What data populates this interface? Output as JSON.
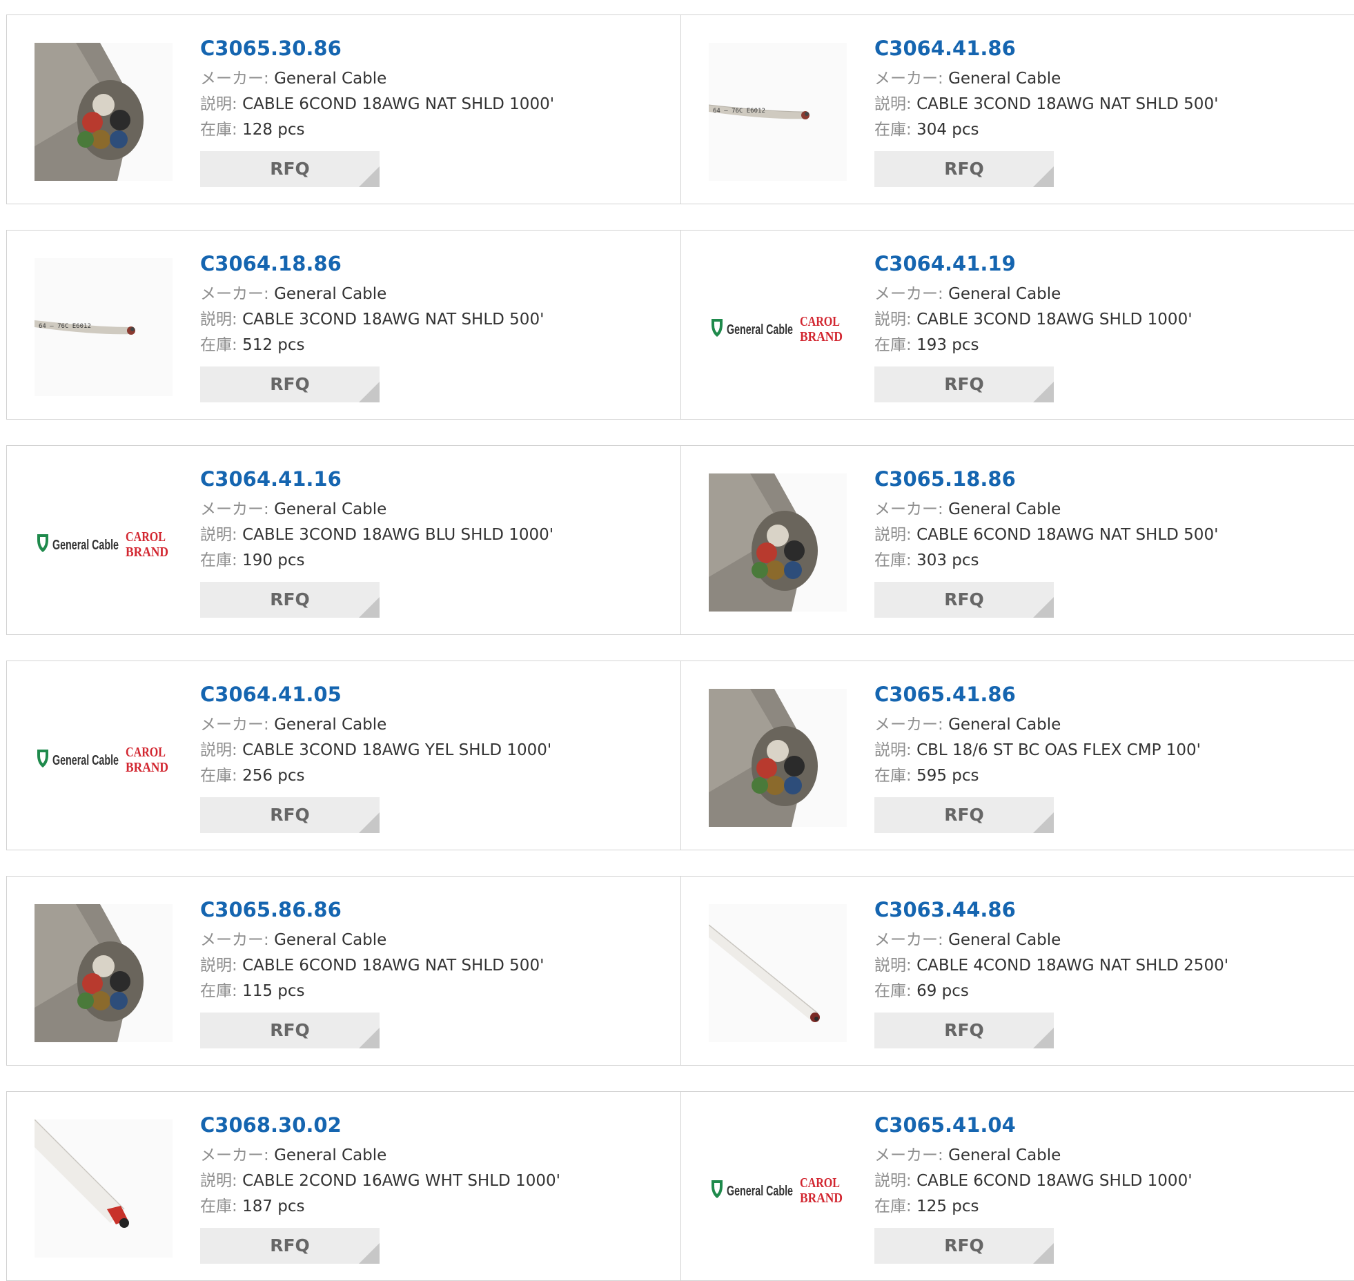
{
  "labels": {
    "maker": "メーカー:",
    "desc": "説明:",
    "stock": "在庫:"
  },
  "products": [
    {
      "pn": "C3065.30.86",
      "maker": "General Cable",
      "desc": "CABLE 6COND 18AWG NAT SHLD 1000'",
      "stock": "128 pcs",
      "rfq": "RFQ",
      "image": "cable-end-multi-icon"
    },
    {
      "pn": "C3064.41.86",
      "maker": "General Cable",
      "desc": "CABLE 3COND 18AWG NAT SHLD 500'",
      "stock": "304 pcs",
      "rfq": "RFQ",
      "image": "cable-thin-printed-icon"
    },
    {
      "pn": "C3064.18.86",
      "maker": "General Cable",
      "desc": "CABLE 3COND 18AWG NAT SHLD 500'",
      "stock": "512 pcs",
      "rfq": "RFQ",
      "image": "cable-thin-printed-icon"
    },
    {
      "pn": "C3064.41.19",
      "maker": "General Cable",
      "desc": "CABLE 3COND 18AWG SHLD 1000'",
      "stock": "193 pcs",
      "rfq": "RFQ",
      "image": "general-cable-logo"
    },
    {
      "pn": "C3064.41.16",
      "maker": "General Cable",
      "desc": "CABLE 3COND 18AWG BLU SHLD 1000'",
      "stock": "190 pcs",
      "rfq": "RFQ",
      "image": "general-cable-logo"
    },
    {
      "pn": "C3065.18.86",
      "maker": "General Cable",
      "desc": "CABLE 6COND 18AWG NAT SHLD 500'",
      "stock": "303 pcs",
      "rfq": "RFQ",
      "image": "cable-end-multi-icon"
    },
    {
      "pn": "C3064.41.05",
      "maker": "General Cable",
      "desc": "CABLE 3COND 18AWG YEL SHLD 1000'",
      "stock": "256 pcs",
      "rfq": "RFQ",
      "image": "general-cable-logo"
    },
    {
      "pn": "C3065.41.86",
      "maker": "General Cable",
      "desc": "CBL 18/6 ST BC OAS FLEX CMP 100'",
      "stock": "595 pcs",
      "rfq": "RFQ",
      "image": "cable-end-multi-icon"
    },
    {
      "pn": "C3065.86.86",
      "maker": "General Cable",
      "desc": "CABLE 6COND 18AWG NAT SHLD 500'",
      "stock": "115 pcs",
      "rfq": "RFQ",
      "image": "cable-end-multi-icon"
    },
    {
      "pn": "C3063.44.86",
      "maker": "General Cable",
      "desc": "CABLE 4COND 18AWG NAT SHLD 2500'",
      "stock": "69 pcs",
      "rfq": "RFQ",
      "image": "cable-white-diagonal-icon"
    },
    {
      "pn": "C3068.30.02",
      "maker": "General Cable",
      "desc": "CABLE 2COND 16AWG WHT SHLD 1000'",
      "stock": "187 pcs",
      "rfq": "RFQ",
      "image": "cable-white-diagonal-icon"
    },
    {
      "pn": "C3065.41.04",
      "maker": "General Cable",
      "desc": "CABLE 6COND 18AWG SHLD 1000'",
      "stock": "125 pcs",
      "rfq": "RFQ",
      "image": "general-cable-logo"
    }
  ],
  "logo": {
    "brand": "General Cable",
    "sub1": "CAROL",
    "sub2": "BRAND"
  },
  "colors": {
    "link": "#1565b0",
    "border": "#d2d2d2",
    "button_bg": "#ececec",
    "button_corner": "#c7c7c7",
    "logo_green": "#1f8a4c",
    "logo_red": "#d22630"
  }
}
